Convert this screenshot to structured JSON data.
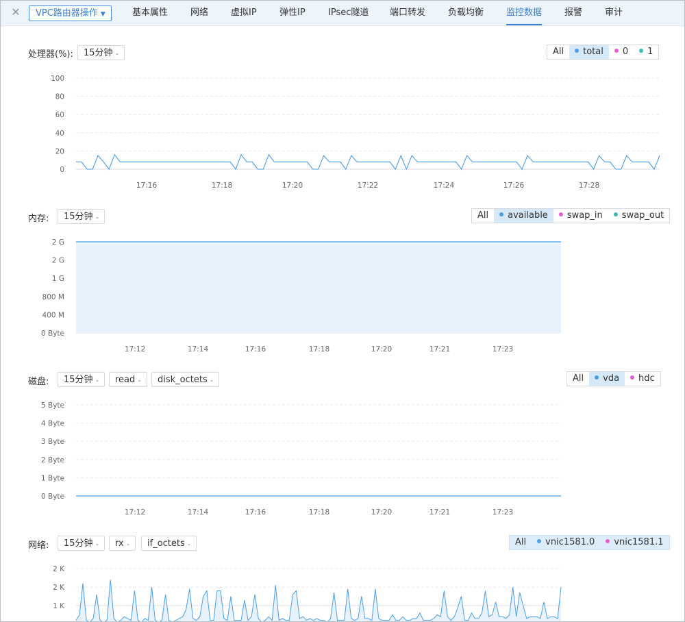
{
  "header": {
    "close_icon": "close-icon",
    "ops_button": "VPC路由器操作",
    "tabs": [
      {
        "label": "基本属性",
        "active": false
      },
      {
        "label": "网络",
        "active": false
      },
      {
        "label": "虚拟IP",
        "active": false
      },
      {
        "label": "弹性IP",
        "active": false
      },
      {
        "label": "IPsec隧道",
        "active": false
      },
      {
        "label": "端口转发",
        "active": false
      },
      {
        "label": "负载均衡",
        "active": false
      },
      {
        "label": "监控数据",
        "active": true
      },
      {
        "label": "报警",
        "active": false
      },
      {
        "label": "审计",
        "active": false
      }
    ]
  },
  "colors": {
    "accent": "#3a7fd1",
    "series_blue": "#4a9ee6",
    "series_pink": "#e85bd2",
    "series_teal": "#3cbdb4",
    "area_fill": "#e7f2fc"
  },
  "sections": {
    "cpu": {
      "label": "处理器(%):",
      "dropdowns": [
        "15分钟"
      ],
      "legend": [
        {
          "label": "All",
          "dot": null,
          "selected": false
        },
        {
          "label": "total",
          "dot": "#4a9ee6",
          "selected": true
        },
        {
          "label": "0",
          "dot": "#e85bd2",
          "selected": false
        },
        {
          "label": "1",
          "dot": "#3cbdb4",
          "selected": false
        }
      ]
    },
    "memory": {
      "label": "内存:",
      "dropdowns": [
        "15分钟"
      ],
      "legend": [
        {
          "label": "All",
          "dot": null,
          "selected": false
        },
        {
          "label": "available",
          "dot": "#4a9ee6",
          "selected": true
        },
        {
          "label": "swap_in",
          "dot": "#e85bd2",
          "selected": false
        },
        {
          "label": "swap_out",
          "dot": "#3cbdb4",
          "selected": false
        }
      ]
    },
    "disk": {
      "label": "磁盘:",
      "dropdowns": [
        "15分钟",
        "read",
        "disk_octets"
      ],
      "legend": [
        {
          "label": "All",
          "dot": null,
          "selected": false
        },
        {
          "label": "vda",
          "dot": "#4a9ee6",
          "selected": true
        },
        {
          "label": "hdc",
          "dot": "#e85bd2",
          "selected": false
        }
      ]
    },
    "network": {
      "label": "网络:",
      "dropdowns": [
        "15分钟",
        "rx",
        "if_octets"
      ],
      "legend": [
        {
          "label": "All",
          "dot": null,
          "selected": false
        },
        {
          "label": "vnic1581.0",
          "dot": "#4a9ee6",
          "selected": false
        },
        {
          "label": "vnic1581.1",
          "dot": "#e85bd2",
          "selected": false
        }
      ]
    }
  },
  "chart_data": [
    {
      "id": "cpu",
      "type": "line",
      "ylabel": "处理器(%)",
      "y_ticks": [
        "0",
        "20",
        "40",
        "60",
        "80",
        "100"
      ],
      "ylim": [
        0,
        100
      ],
      "x_ticks": [
        "17:16",
        "17:18",
        "17:20",
        "17:22",
        "17:24",
        "17:26",
        "17:28"
      ],
      "series": [
        {
          "name": "total",
          "values": [
            8,
            8,
            0,
            0,
            15,
            8,
            0,
            16,
            8,
            8,
            8,
            8,
            8,
            8,
            8,
            8,
            8,
            8,
            8,
            8,
            8,
            8,
            8,
            8,
            8,
            8,
            8,
            8,
            8,
            0,
            16,
            8,
            8,
            0,
            0,
            16,
            8,
            8,
            8,
            8,
            8,
            8,
            8,
            0,
            0,
            15,
            8,
            8,
            8,
            0,
            15,
            8,
            8,
            8,
            8,
            8,
            8,
            8,
            0,
            15,
            0,
            15,
            8,
            8,
            8,
            8,
            8,
            8,
            8,
            8,
            0,
            15,
            8,
            8,
            8,
            8,
            8,
            8,
            8,
            8,
            8,
            0,
            15,
            8,
            8,
            8,
            8,
            8,
            8,
            8,
            8,
            8,
            8,
            8,
            0,
            15,
            8,
            8,
            0,
            0,
            15,
            8,
            8,
            8,
            8,
            0,
            15
          ]
        }
      ]
    },
    {
      "id": "memory",
      "type": "area",
      "ylabel": "内存",
      "y_ticks": [
        "0 Byte",
        "400 M",
        "800 M",
        "1 G",
        "2 G",
        "2 G"
      ],
      "x_ticks": [
        "17:12",
        "17:14",
        "17:16",
        "17:18",
        "17:20",
        "17:21",
        "17:23"
      ],
      "series": [
        {
          "name": "available",
          "values": [
            2,
            2
          ]
        }
      ]
    },
    {
      "id": "disk",
      "type": "line",
      "ylabel": "磁盘",
      "y_ticks": [
        "0 Byte",
        "1 Byte",
        "2 Byte",
        "3 Byte",
        "4 Byte",
        "5 Byte"
      ],
      "ylim": [
        0,
        5
      ],
      "x_ticks": [
        "17:12",
        "17:14",
        "17:16",
        "17:18",
        "17:20",
        "17:21",
        "17:23"
      ],
      "series": [
        {
          "name": "vda",
          "values": [
            0,
            0
          ]
        }
      ]
    },
    {
      "id": "network",
      "type": "area",
      "ylabel": "网络",
      "y_ticks": [
        "1 K",
        "2 K",
        "2 K"
      ],
      "series": [
        {
          "name": "vnic1581.0",
          "values": [
            0.2,
            0.5,
            2.2,
            0.2,
            0.1,
            0.3,
            1.6,
            0.2,
            0.1,
            0.2,
            2.4,
            0.3,
            0.1,
            0.2,
            0.4,
            0.3,
            0.2,
            1.8,
            0.2,
            0.1,
            0.3,
            0.2,
            2.0,
            0.2,
            0.1,
            0.2,
            1.6,
            0.2,
            0.1,
            0.2,
            0.3,
            0.4,
            0.8,
            1.9,
            0.3,
            0.2,
            0.4,
            1.5,
            1.8,
            0.2,
            0.2,
            1.8,
            1.8,
            0.3,
            0.2,
            1.5,
            0.2,
            0.2,
            0.2,
            1.3,
            0.2,
            0.4,
            1.6,
            0.3,
            0.1,
            0.2,
            0.4,
            0.2,
            2.1,
            0.2,
            0.3,
            0.2,
            0.2,
            1.6,
            1.8,
            0.3,
            0.4,
            0.2,
            0.3,
            0.2,
            0.3,
            0.2,
            0.2,
            0.1,
            0.3,
            1.7,
            0.2,
            0.2,
            0.2,
            1.9,
            0.3,
            0.2,
            0.3,
            1.5,
            0.3,
            0.3,
            0.2,
            1.9,
            0.3,
            0.2,
            0.2,
            0.2,
            0.5,
            0.2,
            0.2,
            0.4,
            0.2,
            0.2,
            0.3,
            0.3,
            0.6,
            0.2,
            0.2,
            0.2,
            0.3,
            0.5,
            0.4,
            1.8,
            0.4,
            0.2,
            0.4,
            0.9,
            1.5,
            0.2,
            0.2,
            0.6,
            0.3,
            0.3,
            0.6,
            1.8,
            0.4,
            0.5,
            1.2,
            0.4,
            0.4,
            0.3,
            0.5,
            2.0,
            0.4,
            1.7,
            1.0,
            0.3,
            0.4,
            0.4,
            0.4,
            0.3,
            1.2,
            0.3,
            0.4,
            0.4,
            0.3,
            2.0
          ]
        }
      ]
    }
  ]
}
